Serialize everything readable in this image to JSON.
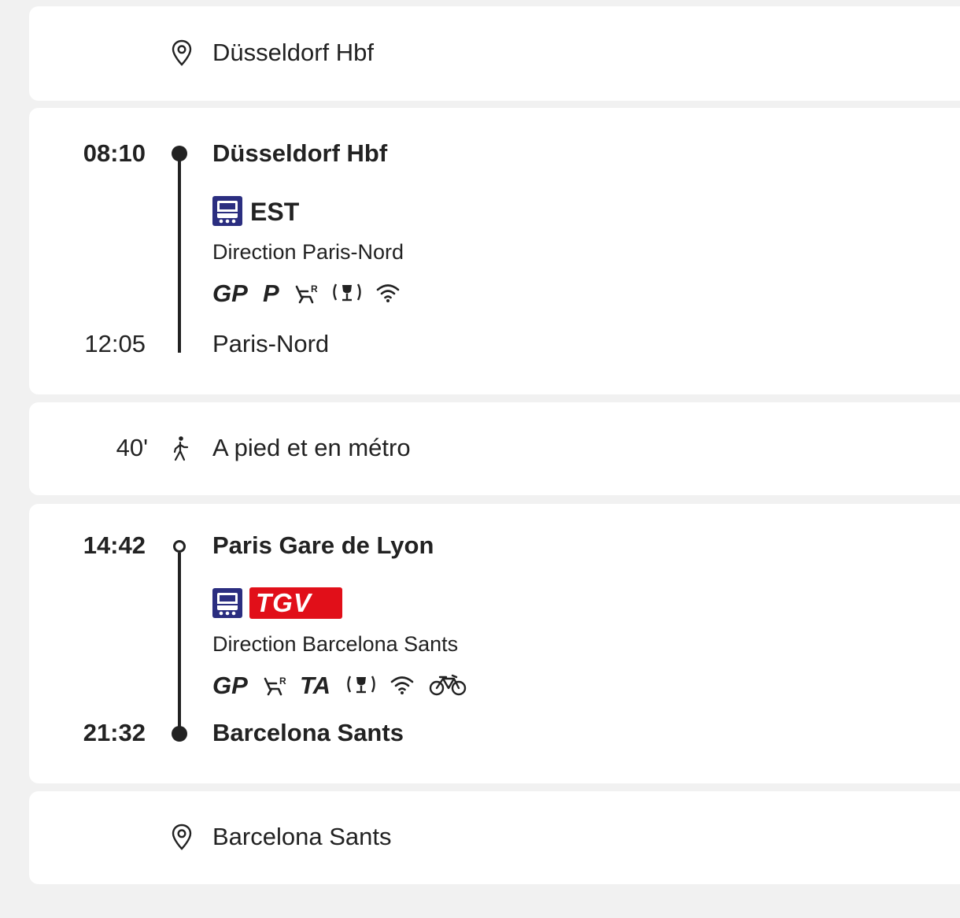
{
  "origin": {
    "station": "Düsseldorf Hbf",
    "icon": "map-pin-icon"
  },
  "leg1": {
    "departure_time": "08:10",
    "departure_station": "Düsseldorf Hbf",
    "line": "EST",
    "direction": "Direction Paris-Nord",
    "services": [
      "GP",
      "P",
      "reserved-seat-icon",
      "bar-service-icon",
      "wifi-icon"
    ],
    "arrival_time": "12:05",
    "arrival_station": "Paris-Nord"
  },
  "transfer": {
    "duration": "40'",
    "label": "A pied et en métro",
    "icon": "walking-person-icon"
  },
  "leg2": {
    "departure_time": "14:42",
    "departure_station": "Paris Gare de Lyon",
    "line": "TGV",
    "direction": "Direction Barcelona Sants",
    "services": [
      "GP",
      "reserved-seat-icon",
      "TA",
      "bar-service-icon",
      "wifi-icon",
      "bicycle-icon"
    ],
    "arrival_time": "21:32",
    "arrival_station": "Barcelona Sants"
  },
  "destination": {
    "station": "Barcelona Sants",
    "icon": "map-pin-icon"
  },
  "colors": {
    "background": "#f1f1f1",
    "card": "#ffffff",
    "text": "#222222",
    "train_badge": "#2b2e80",
    "tgv_badge": "#e10f19"
  }
}
